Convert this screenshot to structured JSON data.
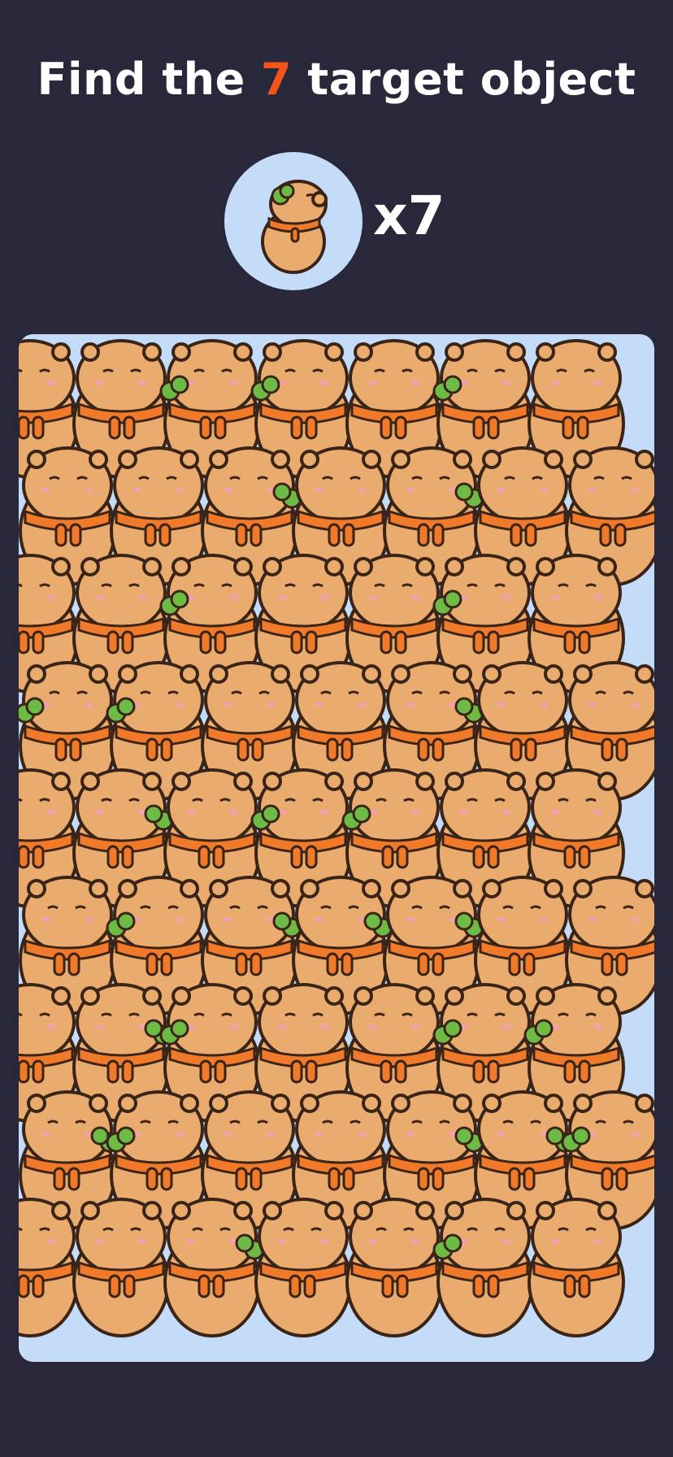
{
  "header": {
    "title_prefix": "Find the ",
    "title_number": "7",
    "title_suffix": " target object"
  },
  "target": {
    "icon": "capybara-with-leaf-icon",
    "count_label": "x7"
  },
  "board": {
    "item_icon": "capybara-icon",
    "target_icon": "capybara-with-leaf-icon",
    "colors": {
      "background": "#28283a",
      "board": "#c4dcf8",
      "body": "#e9ac6e",
      "scarf": "#f07a2a",
      "leaf": "#6dbb45",
      "outline": "#3a2418",
      "accent": "#f2541b"
    }
  }
}
